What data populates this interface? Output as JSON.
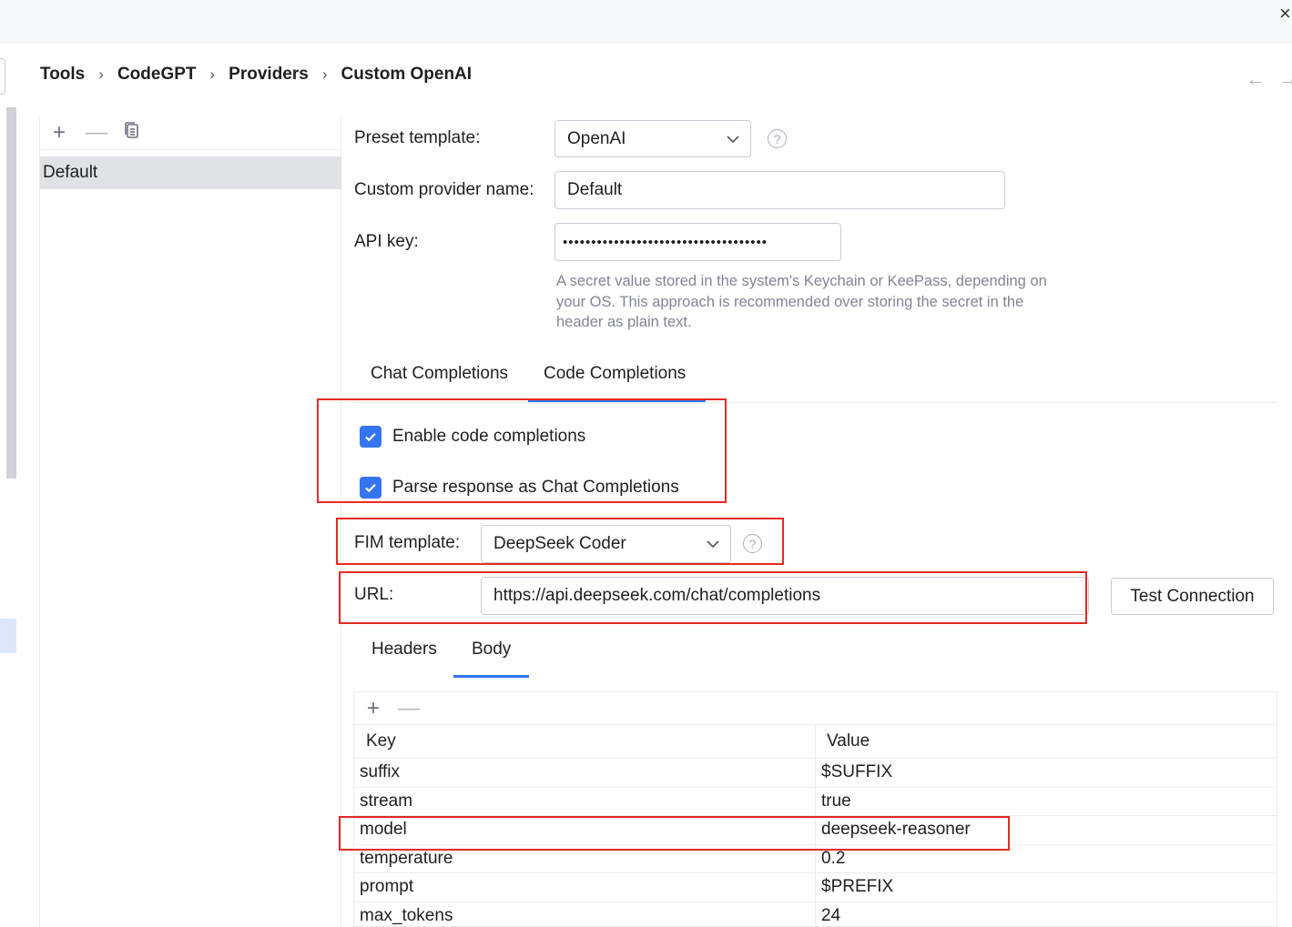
{
  "window": {
    "close_glyph": "×"
  },
  "breadcrumb": [
    "Tools",
    "CodeGPT",
    "Providers",
    "Custom OpenAI"
  ],
  "nav": {
    "back_glyph": "←",
    "forward_glyph": "→"
  },
  "providers_list": {
    "toolbar": {
      "add": "+",
      "remove": "—"
    },
    "items": [
      "Default"
    ]
  },
  "form": {
    "preset_template": {
      "label": "Preset template:",
      "value": "OpenAI"
    },
    "provider_name": {
      "label": "Custom provider name:",
      "value": "Default"
    },
    "api_key": {
      "label": "API key:",
      "value": "••••••••••••••••••••••••••••••••••••",
      "hint": "A secret value stored in the system's Keychain or KeePass, depending on your OS. This approach is recommended over storing the secret in the header as plain text."
    },
    "help_glyph": "?"
  },
  "tabs": {
    "items": [
      "Chat Completions",
      "Code Completions"
    ],
    "active": "Code Completions"
  },
  "code_completions": {
    "enable": {
      "label": "Enable code completions",
      "checked": true
    },
    "parse": {
      "label": "Parse response as Chat Completions",
      "checked": true
    },
    "fim_template": {
      "label": "FIM template:",
      "value": "DeepSeek Coder"
    },
    "url": {
      "label": "URL:",
      "value": "https://api.deepseek.com/chat/completions"
    },
    "test_button": "Test Connection"
  },
  "sub_tabs": {
    "items": [
      "Headers",
      "Body"
    ],
    "active": "Body"
  },
  "body_table": {
    "toolbar": {
      "add": "+",
      "remove": "—"
    },
    "columns": [
      "Key",
      "Value"
    ],
    "rows": [
      {
        "key": "suffix",
        "value": "$SUFFIX"
      },
      {
        "key": "stream",
        "value": "true"
      },
      {
        "key": "model",
        "value": "deepseek-reasoner"
      },
      {
        "key": "temperature",
        "value": "0.2"
      },
      {
        "key": "prompt",
        "value": "$PREFIX"
      },
      {
        "key": "max_tokens",
        "value": "24"
      }
    ]
  },
  "colors": {
    "accent": "#3574f0",
    "highlight_box": "#e52a24",
    "selection": "#dfe1e5"
  }
}
